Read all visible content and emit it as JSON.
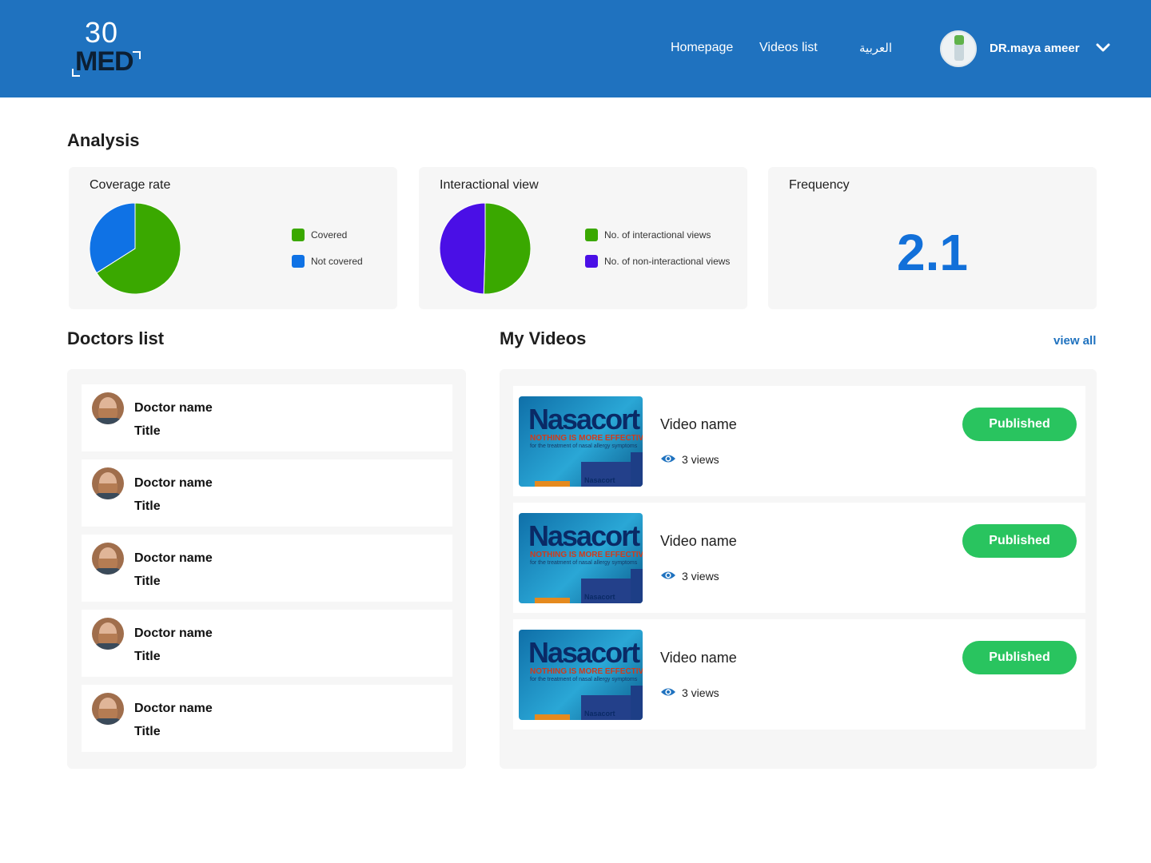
{
  "header": {
    "logo": {
      "number": "30",
      "text": "MED"
    },
    "nav": [
      {
        "label": "Homepage"
      },
      {
        "label": "Videos list"
      },
      {
        "label": "العربية"
      }
    ],
    "user": {
      "name": "DR.maya ameer",
      "menu_icon": "chevron-down-icon"
    }
  },
  "analysis": {
    "title": "Analysis",
    "coverage": {
      "title": "Coverage rate",
      "legend": [
        {
          "label": "Covered",
          "color": "#3aa800"
        },
        {
          "label": "Not covered",
          "color": "#0f72e5"
        }
      ]
    },
    "interactional": {
      "title": "Interactional view",
      "legend": [
        {
          "label": "No. of interactional views",
          "color": "#3aa800"
        },
        {
          "label": "No. of non-interactional views",
          "color": "#4a0fe6"
        }
      ]
    },
    "frequency": {
      "title": "Frequency",
      "value": "2.1"
    }
  },
  "chart_data": [
    {
      "type": "pie",
      "title": "Coverage rate",
      "categories": [
        "Covered",
        "Not covered"
      ],
      "values": [
        66,
        34
      ],
      "colors": [
        "#3aa800",
        "#0f72e5"
      ],
      "legend": "right"
    },
    {
      "type": "pie",
      "title": "Interactional view",
      "categories": [
        "No. of interactional views",
        "No. of non-interactional views"
      ],
      "values": [
        50.5,
        49.5
      ],
      "colors": [
        "#3aa800",
        "#4a0fe6"
      ],
      "legend": "right"
    }
  ],
  "doctors": {
    "title": "Doctors list",
    "items": [
      {
        "name": "Doctor name",
        "title": "Title"
      },
      {
        "name": "Doctor name",
        "title": "Title"
      },
      {
        "name": "Doctor name",
        "title": "Title"
      },
      {
        "name": "Doctor name",
        "title": "Title"
      },
      {
        "name": "Doctor name",
        "title": "Title"
      }
    ]
  },
  "videos": {
    "title": "My Videos",
    "view_all": "view all",
    "thumbnail": {
      "brand": "Nasacort",
      "tagline": "NOTHING IS MORE EFFECTIVE",
      "subline": "for the treatment of nasal allergy symptoms",
      "box_label": "Nasacort"
    },
    "items": [
      {
        "name": "Video name",
        "views": "3 views",
        "status": "Published",
        "status_color": "#29c45f"
      },
      {
        "name": "Video name",
        "views": "3 views",
        "status": "Published",
        "status_color": "#29c45f"
      },
      {
        "name": "Video name",
        "views": "3 views",
        "status": "Published",
        "status_color": "#29c45f"
      }
    ]
  }
}
